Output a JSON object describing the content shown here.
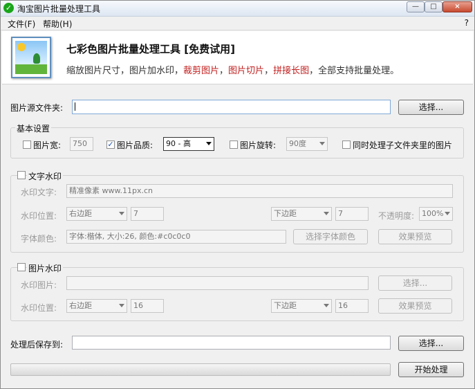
{
  "window": {
    "title": "淘宝图片批量处理工具",
    "app_icon": "check-circle-icon"
  },
  "menu": {
    "file": "文件(F)",
    "help": "帮助(H)",
    "help_question": "?"
  },
  "banner": {
    "title": "七彩色图片批量处理工具 [免费试用]",
    "desc_1": "缩放图片尺寸，图片加水印，",
    "desc_red_1": "裁剪图片",
    "sep_1": "，",
    "desc_red_2": "图片切片",
    "sep_2": "，",
    "desc_red_3": "拼接长图",
    "desc_2": "，全部支持批量处理。"
  },
  "source": {
    "label": "图片源文件夹:",
    "value": "",
    "button": "选择..."
  },
  "basic": {
    "group": "基本设置",
    "width_label": "图片宽:",
    "width_value": "750",
    "quality_label": "图片品质:",
    "quality_value": "90 - 高",
    "rotate_label": "图片旋转:",
    "rotate_value": "90度",
    "subfolder_label": "同时处理子文件夹里的图片",
    "width_checked": false,
    "quality_checked": true,
    "rotate_checked": false,
    "subfolder_checked": false
  },
  "text_watermark": {
    "group": "文字水印",
    "text_label": "水印文字:",
    "text_value": "精准像素 www.11px.cn",
    "pos_label": "水印位置:",
    "pos_h": "右边距",
    "pos_h_value": "7",
    "pos_v": "下边距",
    "pos_v_value": "7",
    "opacity_label": "不透明度:",
    "opacity_value": "100%",
    "font_label": "字体颜色:",
    "font_value": "字体:楷体, 大小:26, 颜色:#c0c0c0",
    "font_button": "选择字体颜色",
    "preview_button": "效果预览",
    "checked": false
  },
  "image_watermark": {
    "group": "图片水印",
    "img_label": "水印图片:",
    "img_value": "",
    "select_button": "选择...",
    "pos_label": "水印位置:",
    "pos_h": "右边距",
    "pos_h_value": "16",
    "pos_v": "下边距",
    "pos_v_value": "16",
    "preview_button": "效果预览",
    "checked": false
  },
  "output": {
    "label": "处理后保存到:",
    "value": "",
    "button": "选择..."
  },
  "progress": {
    "value": 0
  },
  "actions": {
    "start": "开始处理"
  },
  "colors": {
    "highlight_red": "#c21f1f",
    "banner_bg": "#ffffff",
    "window_bg": "#f0f0f0"
  }
}
